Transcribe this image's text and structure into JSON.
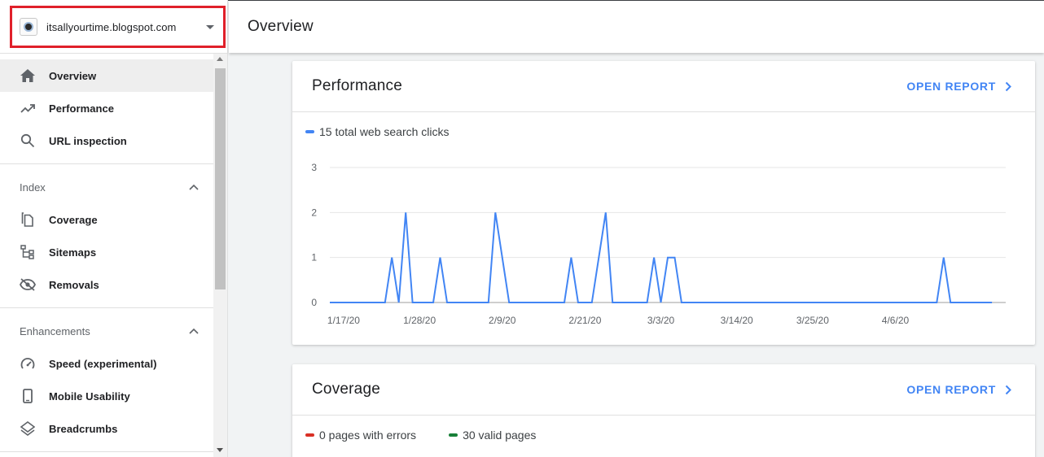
{
  "property": {
    "name": "itsallyourtime.blogspot.com"
  },
  "header": {
    "title": "Overview"
  },
  "nav": {
    "top_items": [
      {
        "label": "Overview",
        "icon": "home-icon",
        "active": true
      },
      {
        "label": "Performance",
        "icon": "trending-up-icon"
      },
      {
        "label": "URL inspection",
        "icon": "search-icon"
      }
    ],
    "sections": [
      {
        "title": "Index",
        "items": [
          {
            "label": "Coverage",
            "icon": "file-copy-icon"
          },
          {
            "label": "Sitemaps",
            "icon": "sitemap-icon"
          },
          {
            "label": "Removals",
            "icon": "eye-off-icon"
          }
        ]
      },
      {
        "title": "Enhancements",
        "items": [
          {
            "label": "Speed (experimental)",
            "icon": "speedometer-icon"
          },
          {
            "label": "Mobile Usability",
            "icon": "smartphone-icon"
          },
          {
            "label": "Breadcrumbs",
            "icon": "layers-icon"
          }
        ]
      }
    ]
  },
  "performance": {
    "title": "Performance",
    "open_report": "OPEN REPORT",
    "legend": "15 total web search clicks",
    "legend_color": "#4285f4"
  },
  "coverage": {
    "title": "Coverage",
    "open_report": "OPEN REPORT",
    "legend": [
      {
        "label": "0 pages with errors",
        "color": "#d93025"
      },
      {
        "label": "30 valid pages",
        "color": "#188038"
      }
    ]
  },
  "chart_data": {
    "type": "line",
    "series": [
      {
        "color": "#4285f4",
        "points": [
          [
            "2020-01-15",
            0
          ],
          [
            "2020-01-23",
            0
          ],
          [
            "2020-01-24",
            1
          ],
          [
            "2020-01-25",
            0
          ],
          [
            "2020-01-26",
            2
          ],
          [
            "2020-01-27",
            0
          ],
          [
            "2020-01-30",
            0
          ],
          [
            "2020-01-31",
            1
          ],
          [
            "2020-02-01",
            0
          ],
          [
            "2020-02-07",
            0
          ],
          [
            "2020-02-08",
            2
          ],
          [
            "2020-02-10",
            0
          ],
          [
            "2020-02-18",
            0
          ],
          [
            "2020-02-19",
            1
          ],
          [
            "2020-02-20",
            0
          ],
          [
            "2020-02-22",
            0
          ],
          [
            "2020-02-24",
            2
          ],
          [
            "2020-02-25",
            0
          ],
          [
            "2020-03-01",
            0
          ],
          [
            "2020-03-02",
            1
          ],
          [
            "2020-03-03",
            0
          ],
          [
            "2020-03-04",
            1
          ],
          [
            "2020-03-05",
            1
          ],
          [
            "2020-03-06",
            0
          ],
          [
            "2020-04-12",
            0
          ],
          [
            "2020-04-13",
            1
          ],
          [
            "2020-04-14",
            0
          ],
          [
            "2020-04-20",
            0
          ]
        ]
      }
    ],
    "x_ticks": [
      {
        "date": "2020-01-17",
        "label": "1/17/20"
      },
      {
        "date": "2020-01-28",
        "label": "1/28/20"
      },
      {
        "date": "2020-02-09",
        "label": "2/9/20"
      },
      {
        "date": "2020-02-21",
        "label": "2/21/20"
      },
      {
        "date": "2020-03-03",
        "label": "3/3/20"
      },
      {
        "date": "2020-03-14",
        "label": "3/14/20"
      },
      {
        "date": "2020-03-25",
        "label": "3/25/20"
      },
      {
        "date": "2020-04-06",
        "label": "4/6/20"
      }
    ],
    "y_ticks": [
      0,
      1,
      2,
      3
    ],
    "ylim": [
      0,
      3
    ],
    "xlim": [
      "2020-01-15",
      "2020-04-22"
    ],
    "grid": true
  }
}
